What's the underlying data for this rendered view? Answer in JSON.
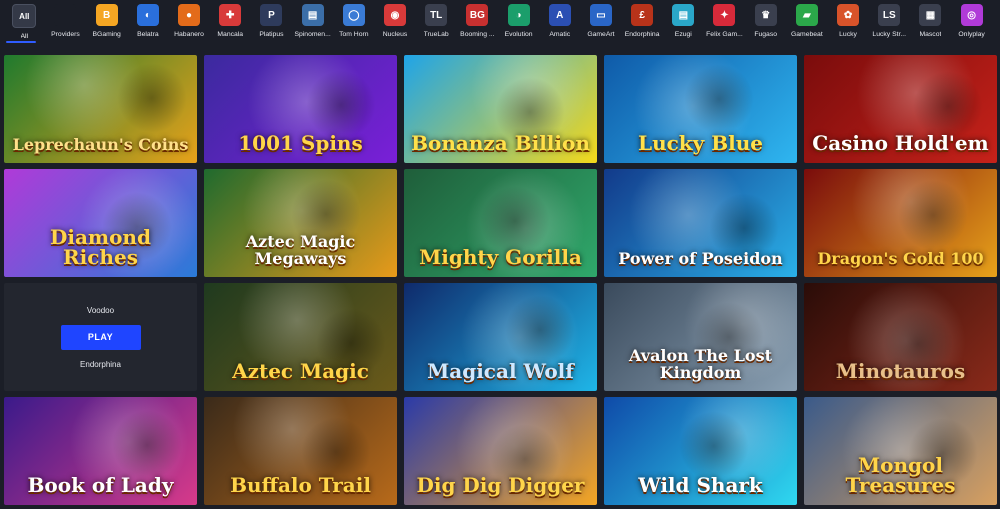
{
  "providers": [
    {
      "label": "All",
      "icon": "All",
      "color": "#343947"
    },
    {
      "label": "Providers",
      "icon": "",
      "color": "#1b1e27"
    },
    {
      "label": "BGaming",
      "icon": "B",
      "color": "#f5a623"
    },
    {
      "label": "Belatra",
      "icon": "◐",
      "color": "#2a6fdb"
    },
    {
      "label": "Habanero",
      "icon": "●",
      "color": "#e36b1a"
    },
    {
      "label": "Mancala",
      "icon": "✚",
      "color": "#d83a3a"
    },
    {
      "label": "Platipus",
      "icon": "P",
      "color": "#2e3b5c"
    },
    {
      "label": "Spinomen...",
      "icon": "▤",
      "color": "#3b6ea8"
    },
    {
      "label": "Tom Horn",
      "icon": "◯",
      "color": "#3a7bd5"
    },
    {
      "label": "Nucleus",
      "icon": "◉",
      "color": "#d83a3a"
    },
    {
      "label": "TrueLab",
      "icon": "TL",
      "color": "#3a3f4e"
    },
    {
      "label": "Booming ...",
      "icon": "BG",
      "color": "#c73030"
    },
    {
      "label": "Evolution",
      "icon": "◑",
      "color": "#1b9e6b"
    },
    {
      "label": "Amatic",
      "icon": "A",
      "color": "#2b4fb3"
    },
    {
      "label": "GameArt",
      "icon": "▭",
      "color": "#2a66c7"
    },
    {
      "label": "Endorphina",
      "icon": "£",
      "color": "#b8331a"
    },
    {
      "label": "Ezugi",
      "icon": "▤",
      "color": "#2aa7c9"
    },
    {
      "label": "Felix Gam...",
      "icon": "✦",
      "color": "#d72a3a"
    },
    {
      "label": "Fugaso",
      "icon": "♛",
      "color": "#3a3f4e"
    },
    {
      "label": "Gamebeat",
      "icon": "▰",
      "color": "#2ba84a"
    },
    {
      "label": "Lucky",
      "icon": "✿",
      "color": "#d8532a"
    },
    {
      "label": "Lucky Str...",
      "icon": "LS",
      "color": "#3a3f4e"
    },
    {
      "label": "Mascot",
      "icon": "▦",
      "color": "#3a3f4e"
    },
    {
      "label": "Onlyplay",
      "icon": "◎",
      "color": "#b03ad8"
    }
  ],
  "games": [
    {
      "title": "Leprechaun's Coins",
      "bg1": "#1f7a2e",
      "bg2": "#e8a21a",
      "text": "#ffe08a"
    },
    {
      "title": "1001 Spins",
      "bg1": "#3b2a9e",
      "bg2": "#7a1fd8",
      "text": "#ffd54a"
    },
    {
      "title": "Bonanza Billion",
      "bg1": "#1fa4e8",
      "bg2": "#f5d91a",
      "text": "#ffe14a"
    },
    {
      "title": "Lucky Blue",
      "bg1": "#0f5aa8",
      "bg2": "#2fb6f0",
      "text": "#ffe14a"
    },
    {
      "title": "Casino Hold'em",
      "bg1": "#7a0c0c",
      "bg2": "#c7221a",
      "text": "#ffffff"
    },
    {
      "title": "Diamond Riches",
      "bg1": "#b03ad8",
      "bg2": "#2a7bd8",
      "text": "#ffd54a"
    },
    {
      "title": "Aztec Magic Megaways",
      "bg1": "#1f6a2e",
      "bg2": "#e89a1a",
      "text": "#ffffff"
    },
    {
      "title": "Mighty Gorilla",
      "bg1": "#1f5e3a",
      "bg2": "#2fa86b",
      "text": "#ffd54a"
    },
    {
      "title": "Power of Poseidon",
      "bg1": "#123a8a",
      "bg2": "#2ab0e8",
      "text": "#ffffff"
    },
    {
      "title": "Dragon's Gold 100",
      "bg1": "#7a0c0c",
      "bg2": "#e8a21a",
      "text": "#ffd54a"
    },
    {
      "title": "",
      "bg1": "#23262f",
      "bg2": "#23262f",
      "text": "#ffffff"
    },
    {
      "title": "Aztec Magic",
      "bg1": "#1f3a1f",
      "bg2": "#6b5a1a",
      "text": "#ffd54a"
    },
    {
      "title": "Magical Wolf",
      "bg1": "#0f2a6b",
      "bg2": "#1fb6e8",
      "text": "#cfe9ff"
    },
    {
      "title": "Avalon The Lost Kingdom",
      "bg1": "#3a4a5c",
      "bg2": "#8aa0b3",
      "text": "#ffffff"
    },
    {
      "title": "Minotauros",
      "bg1": "#2a0c08",
      "bg2": "#8a2a1a",
      "text": "#e8c08a"
    },
    {
      "title": "Book of Lady",
      "bg1": "#3a1a8a",
      "bg2": "#d83a8a",
      "text": "#ffffff"
    },
    {
      "title": "Buffalo Trail",
      "bg1": "#3a2a1a",
      "bg2": "#b86a1a",
      "text": "#ffd54a"
    },
    {
      "title": "Dig Dig Digger",
      "bg1": "#2a3aa8",
      "bg2": "#f5a623",
      "text": "#ffd54a"
    },
    {
      "title": "Wild Shark",
      "bg1": "#0f4aa8",
      "bg2": "#2fd8f0",
      "text": "#ffffff"
    },
    {
      "title": "Mongol Treasures",
      "bg1": "#3a5a8a",
      "bg2": "#d8a060",
      "text": "#ffd54a"
    }
  ],
  "hover_tile": {
    "provider": "Voodoo",
    "play_label": "PLAY",
    "sub": "Endorphina"
  }
}
